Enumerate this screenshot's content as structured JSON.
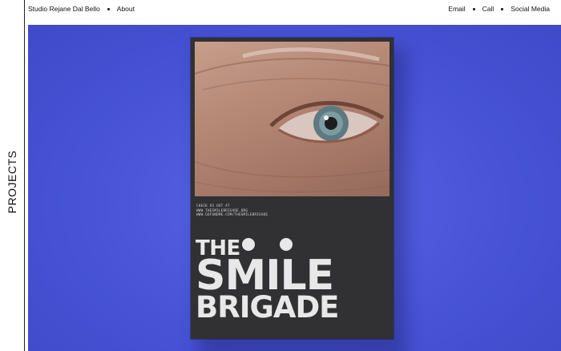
{
  "rail": {
    "label": "PROJECTS"
  },
  "nav": {
    "studio": "Studio Rejane Dal Bello",
    "about": "About",
    "email": "Email",
    "call": "Call",
    "social": "Social Media"
  },
  "poster": {
    "credits": [
      "CHECK US OUT AT",
      "WWW.THESMILEBRIGADE.ORG",
      "WWW.GOFUNDME.COM/THESMILEBRIGADE"
    ],
    "title_the": "THE",
    "title_smile": "SMILE",
    "title_brigade": "BRIGADE"
  },
  "colors": {
    "hero_bg": "#4a55d8",
    "poster_bg": "#313133",
    "title": "#e8e8e8"
  }
}
